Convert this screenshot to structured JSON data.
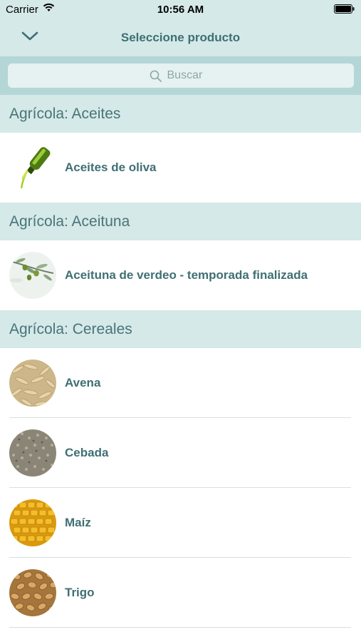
{
  "status_bar": {
    "carrier": "Carrier",
    "time": "10:56 AM"
  },
  "nav": {
    "title": "Seleccione producto"
  },
  "search": {
    "placeholder": "Buscar"
  },
  "sections": [
    {
      "title": "Agrícola: Aceites",
      "items": [
        {
          "label": "Aceites de oliva",
          "icon": "olive-oil-bottle-icon"
        }
      ]
    },
    {
      "title": "Agrícola: Aceituna",
      "items": [
        {
          "label": "Aceituna de verdeo - temporada finalizada",
          "icon": "olive-branch-thumbnail"
        }
      ]
    },
    {
      "title": "Agrícola: Cereales",
      "items": [
        {
          "label": "Avena",
          "icon": "oat-thumbnail"
        },
        {
          "label": "Cebada",
          "icon": "barley-thumbnail"
        },
        {
          "label": "Maíz",
          "icon": "corn-thumbnail"
        },
        {
          "label": "Trigo",
          "icon": "wheat-thumbnail"
        }
      ]
    }
  ],
  "colors": {
    "nav_bg": "#d4e9e8",
    "search_bg": "#b5d6d6",
    "text_teal": "#3f6f73"
  }
}
